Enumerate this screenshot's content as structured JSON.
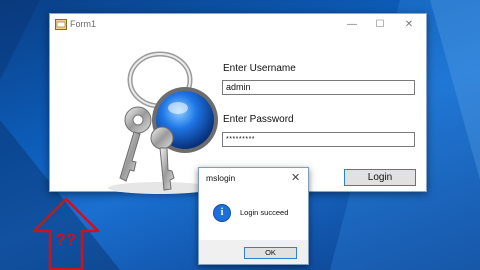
{
  "window": {
    "title": "Form1",
    "controls": {
      "minimize": "—",
      "maximize": "☐",
      "close": "✕"
    }
  },
  "form": {
    "username_label": "Enter Username",
    "username_value": "admin",
    "password_label": "Enter Password",
    "password_value": "*********",
    "login_button": "Login"
  },
  "dialog": {
    "title": "mslogin",
    "close": "✕",
    "message": "Login succeed",
    "ok_button": "OK",
    "icon": "info-icon"
  },
  "overlay": {
    "arrow_text": "??"
  },
  "colors": {
    "desktop": "#0d5cb8",
    "accent": "#2f7fd6",
    "arrow": "#c9141b"
  }
}
